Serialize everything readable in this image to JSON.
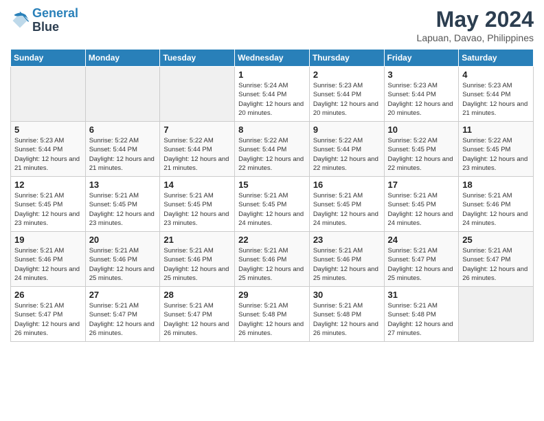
{
  "header": {
    "logo_line1": "General",
    "logo_line2": "Blue",
    "month": "May 2024",
    "location": "Lapuan, Davao, Philippines"
  },
  "days_of_week": [
    "Sunday",
    "Monday",
    "Tuesday",
    "Wednesday",
    "Thursday",
    "Friday",
    "Saturday"
  ],
  "weeks": [
    [
      {
        "day": "",
        "empty": true
      },
      {
        "day": "",
        "empty": true
      },
      {
        "day": "",
        "empty": true
      },
      {
        "day": "1",
        "sunrise": "5:24 AM",
        "sunset": "5:44 PM",
        "daylight": "12 hours and 20 minutes."
      },
      {
        "day": "2",
        "sunrise": "5:23 AM",
        "sunset": "5:44 PM",
        "daylight": "12 hours and 20 minutes."
      },
      {
        "day": "3",
        "sunrise": "5:23 AM",
        "sunset": "5:44 PM",
        "daylight": "12 hours and 20 minutes."
      },
      {
        "day": "4",
        "sunrise": "5:23 AM",
        "sunset": "5:44 PM",
        "daylight": "12 hours and 21 minutes."
      }
    ],
    [
      {
        "day": "5",
        "sunrise": "5:23 AM",
        "sunset": "5:44 PM",
        "daylight": "12 hours and 21 minutes."
      },
      {
        "day": "6",
        "sunrise": "5:22 AM",
        "sunset": "5:44 PM",
        "daylight": "12 hours and 21 minutes."
      },
      {
        "day": "7",
        "sunrise": "5:22 AM",
        "sunset": "5:44 PM",
        "daylight": "12 hours and 21 minutes."
      },
      {
        "day": "8",
        "sunrise": "5:22 AM",
        "sunset": "5:44 PM",
        "daylight": "12 hours and 22 minutes."
      },
      {
        "day": "9",
        "sunrise": "5:22 AM",
        "sunset": "5:44 PM",
        "daylight": "12 hours and 22 minutes."
      },
      {
        "day": "10",
        "sunrise": "5:22 AM",
        "sunset": "5:45 PM",
        "daylight": "12 hours and 22 minutes."
      },
      {
        "day": "11",
        "sunrise": "5:22 AM",
        "sunset": "5:45 PM",
        "daylight": "12 hours and 23 minutes."
      }
    ],
    [
      {
        "day": "12",
        "sunrise": "5:21 AM",
        "sunset": "5:45 PM",
        "daylight": "12 hours and 23 minutes."
      },
      {
        "day": "13",
        "sunrise": "5:21 AM",
        "sunset": "5:45 PM",
        "daylight": "12 hours and 23 minutes."
      },
      {
        "day": "14",
        "sunrise": "5:21 AM",
        "sunset": "5:45 PM",
        "daylight": "12 hours and 23 minutes."
      },
      {
        "day": "15",
        "sunrise": "5:21 AM",
        "sunset": "5:45 PM",
        "daylight": "12 hours and 24 minutes."
      },
      {
        "day": "16",
        "sunrise": "5:21 AM",
        "sunset": "5:45 PM",
        "daylight": "12 hours and 24 minutes."
      },
      {
        "day": "17",
        "sunrise": "5:21 AM",
        "sunset": "5:45 PM",
        "daylight": "12 hours and 24 minutes."
      },
      {
        "day": "18",
        "sunrise": "5:21 AM",
        "sunset": "5:46 PM",
        "daylight": "12 hours and 24 minutes."
      }
    ],
    [
      {
        "day": "19",
        "sunrise": "5:21 AM",
        "sunset": "5:46 PM",
        "daylight": "12 hours and 24 minutes."
      },
      {
        "day": "20",
        "sunrise": "5:21 AM",
        "sunset": "5:46 PM",
        "daylight": "12 hours and 25 minutes."
      },
      {
        "day": "21",
        "sunrise": "5:21 AM",
        "sunset": "5:46 PM",
        "daylight": "12 hours and 25 minutes."
      },
      {
        "day": "22",
        "sunrise": "5:21 AM",
        "sunset": "5:46 PM",
        "daylight": "12 hours and 25 minutes."
      },
      {
        "day": "23",
        "sunrise": "5:21 AM",
        "sunset": "5:46 PM",
        "daylight": "12 hours and 25 minutes."
      },
      {
        "day": "24",
        "sunrise": "5:21 AM",
        "sunset": "5:47 PM",
        "daylight": "12 hours and 25 minutes."
      },
      {
        "day": "25",
        "sunrise": "5:21 AM",
        "sunset": "5:47 PM",
        "daylight": "12 hours and 26 minutes."
      }
    ],
    [
      {
        "day": "26",
        "sunrise": "5:21 AM",
        "sunset": "5:47 PM",
        "daylight": "12 hours and 26 minutes."
      },
      {
        "day": "27",
        "sunrise": "5:21 AM",
        "sunset": "5:47 PM",
        "daylight": "12 hours and 26 minutes."
      },
      {
        "day": "28",
        "sunrise": "5:21 AM",
        "sunset": "5:47 PM",
        "daylight": "12 hours and 26 minutes."
      },
      {
        "day": "29",
        "sunrise": "5:21 AM",
        "sunset": "5:48 PM",
        "daylight": "12 hours and 26 minutes."
      },
      {
        "day": "30",
        "sunrise": "5:21 AM",
        "sunset": "5:48 PM",
        "daylight": "12 hours and 26 minutes."
      },
      {
        "day": "31",
        "sunrise": "5:21 AM",
        "sunset": "5:48 PM",
        "daylight": "12 hours and 27 minutes."
      },
      {
        "day": "",
        "empty": true
      }
    ]
  ]
}
